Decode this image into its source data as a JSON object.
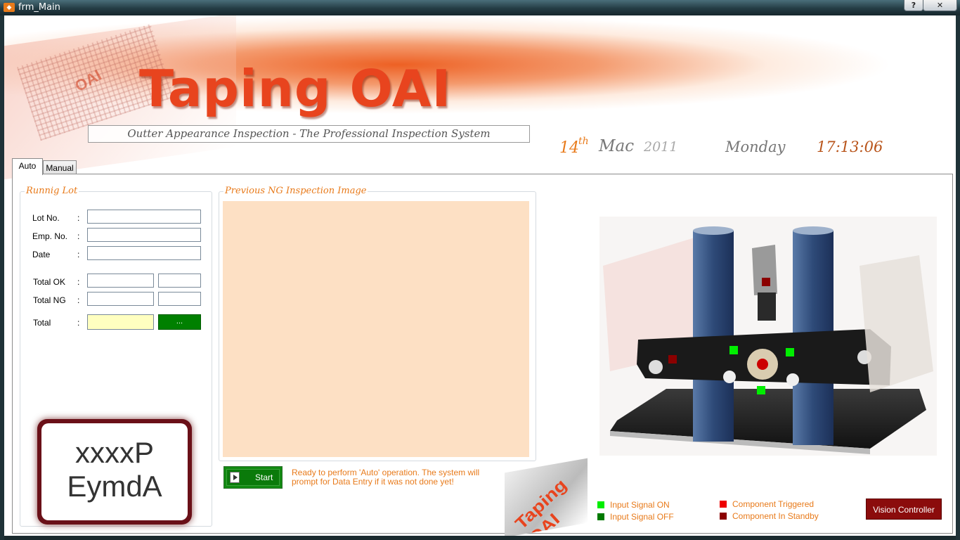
{
  "window": {
    "title": "frm_Main",
    "help_label": "?",
    "close_label": "✕"
  },
  "banner": {
    "title": "Taping OAI",
    "subtitle": "Outter Appearance Inspection - The Professional Inspection System",
    "logo_text": "OAI"
  },
  "datetime": {
    "day": "14",
    "day_suffix": "th",
    "month": "Mac",
    "year": "2011",
    "weekday": "Monday",
    "time": "17:13:06"
  },
  "tabs": [
    {
      "label": "Auto",
      "active": true
    },
    {
      "label": "Manual",
      "active": false
    }
  ],
  "running_lot": {
    "title": "Runnig Lot",
    "fields": [
      {
        "label": "Lot No.",
        "value": ""
      },
      {
        "label": "Emp. No.",
        "value": ""
      },
      {
        "label": "Date",
        "value": ""
      },
      {
        "label": "Total OK",
        "value": "",
        "value2": ""
      },
      {
        "label": "Total NG",
        "value": "",
        "value2": ""
      },
      {
        "label": "Total",
        "value": "",
        "button": "..."
      }
    ],
    "colon": ":",
    "stamp": [
      "xxxxP",
      "EymdA"
    ]
  },
  "inspection_image": {
    "title": "Previous NG Inspection Image"
  },
  "controls": {
    "start_label": "Start",
    "status": "Ready to perform 'Auto' operation. The system will prompt for Data Entry if it was not done yet!",
    "logo_text": "Taping OAI"
  },
  "legend": [
    {
      "label": "Input Signal ON",
      "color": "#00ee00"
    },
    {
      "label": "Input Signal OFF",
      "color": "#007a00"
    },
    {
      "label": "Component Triggered",
      "color": "#ee0000"
    },
    {
      "label": "Component In Standby",
      "color": "#8b0000"
    }
  ],
  "vision_controller_label": "Vision Controller",
  "colors": {
    "accent": "#e87a1a",
    "brand": "#e8441e",
    "ok_green": "#008000",
    "controller": "#8b0c0c"
  }
}
